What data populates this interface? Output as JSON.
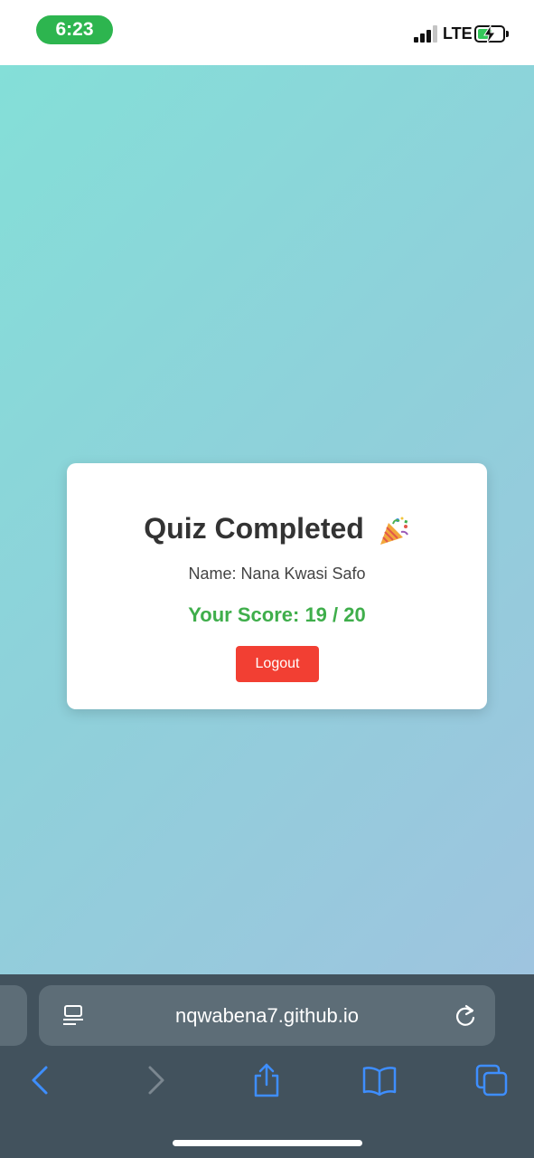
{
  "status_bar": {
    "time": "6:23",
    "network": "LTE",
    "icons": [
      "signal-icon",
      "battery-charging-icon"
    ]
  },
  "quiz": {
    "title": "Quiz Completed",
    "title_icon": "party-popper-icon",
    "name_line": "Name: Nana Kwasi Safo",
    "score_line": "Your Score: 19 / 20",
    "score": 19,
    "total": 20,
    "logout_label": "Logout"
  },
  "browser": {
    "url": "nqwabena7.github.io",
    "toolbar_icons": [
      "back-icon",
      "forward-icon",
      "share-icon",
      "bookmarks-icon",
      "tabs-icon"
    ]
  },
  "colors": {
    "time_pill": "#2db54f",
    "score_text": "#3fae4b",
    "logout_button": "#f23f33",
    "browser_chrome": "#42525d",
    "toolbar_accent": "#3e8eff"
  }
}
